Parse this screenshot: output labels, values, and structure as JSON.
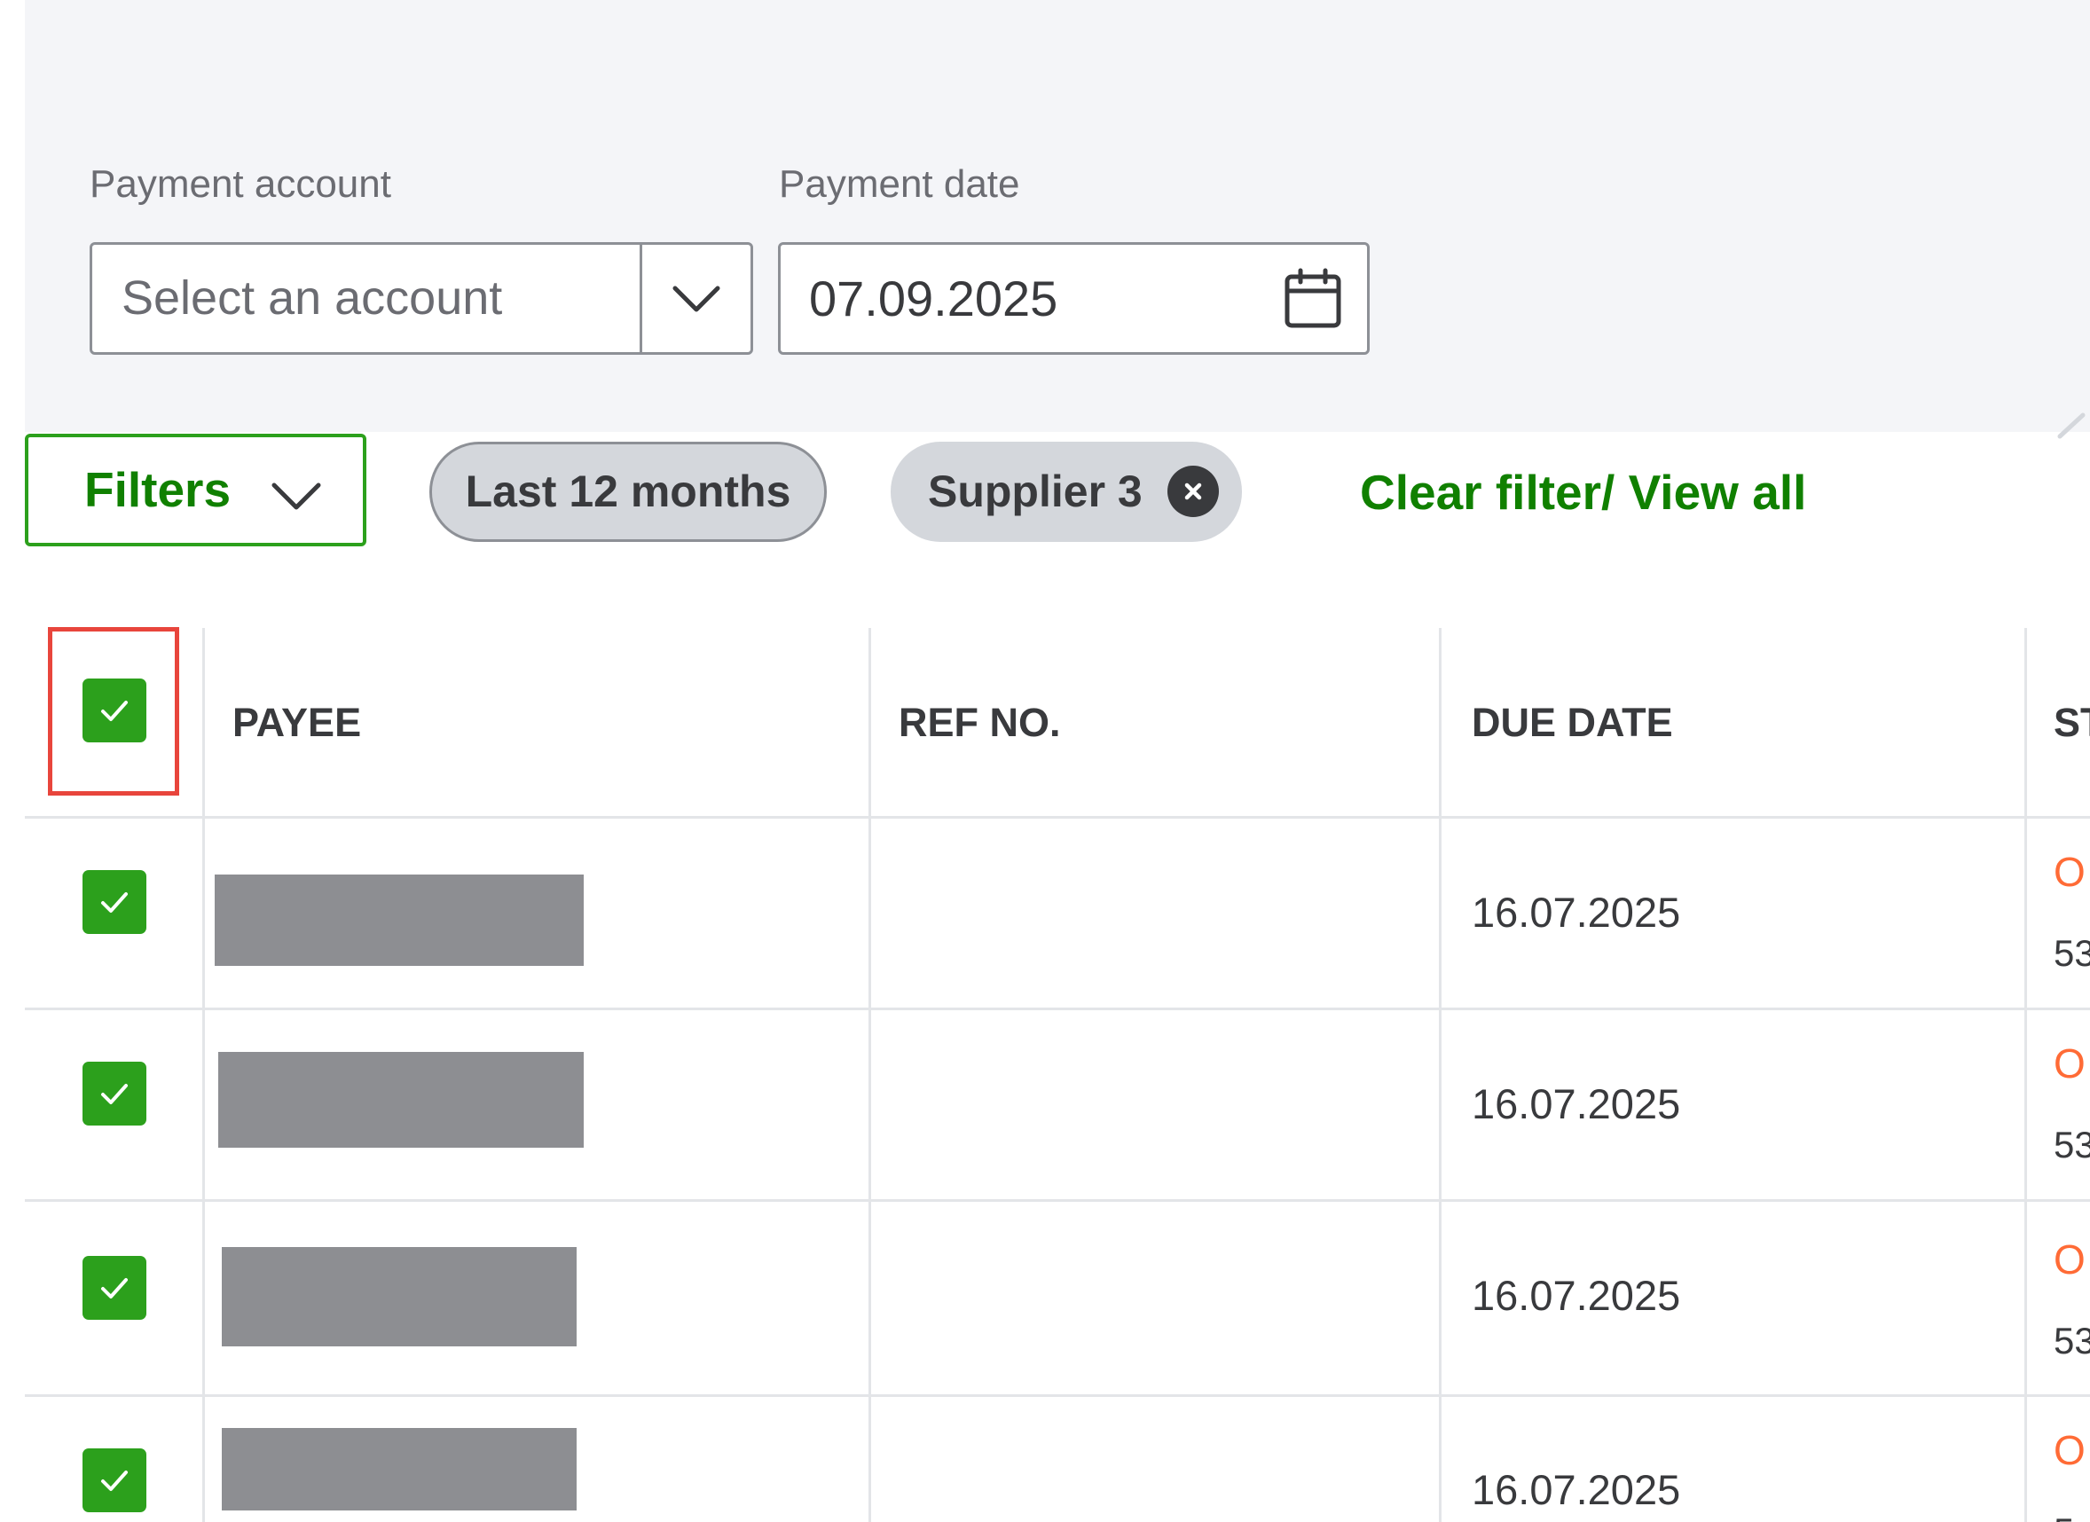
{
  "filters_panel": {
    "payment_account": {
      "label": "Payment account",
      "placeholder": "Select an account",
      "value": ""
    },
    "payment_date": {
      "label": "Payment date",
      "value": "07.09.2025"
    }
  },
  "filter_bar": {
    "filters_button_label": "Filters",
    "chips": [
      {
        "label": "Last 12 months",
        "removable": false
      },
      {
        "label": "Supplier 3",
        "removable": true
      }
    ],
    "clear_link_label": "Clear filter/ View all"
  },
  "table": {
    "select_all_checked": true,
    "columns": [
      {
        "key": "payee",
        "label": "PAYEE"
      },
      {
        "key": "ref_no",
        "label": "REF NO."
      },
      {
        "key": "due_date",
        "label": "DUE DATE"
      },
      {
        "key": "status",
        "label": "ST"
      }
    ],
    "rows": [
      {
        "checked": true,
        "payee": "",
        "payee_redacted": true,
        "ref_no": "",
        "due_date": "16.07.2025",
        "status": "O",
        "status_sub": "53"
      },
      {
        "checked": true,
        "payee": "",
        "payee_redacted": true,
        "ref_no": "",
        "due_date": "16.07.2025",
        "status": "O",
        "status_sub": "53"
      },
      {
        "checked": true,
        "payee": "",
        "payee_redacted": true,
        "ref_no": "",
        "due_date": "16.07.2025",
        "status": "O",
        "status_sub": "53"
      },
      {
        "checked": true,
        "payee": "",
        "payee_redacted": true,
        "ref_no": "",
        "due_date": "16.07.2025",
        "status": "O",
        "status_sub": "5"
      }
    ]
  },
  "colors": {
    "primary_green": "#2ca01c",
    "link_green": "#108000",
    "status_orange": "#ff6b36",
    "highlight_red": "#e8453c",
    "chip_gray": "#d4d7dc",
    "panel_bg": "#f4f5f8"
  },
  "icons": {
    "account_dropdown": "chevron-down-icon",
    "date_picker": "calendar-icon",
    "filters_dropdown": "chevron-down-icon",
    "chip_remove": "close-circle-icon",
    "checkbox": "checkmark-icon"
  }
}
